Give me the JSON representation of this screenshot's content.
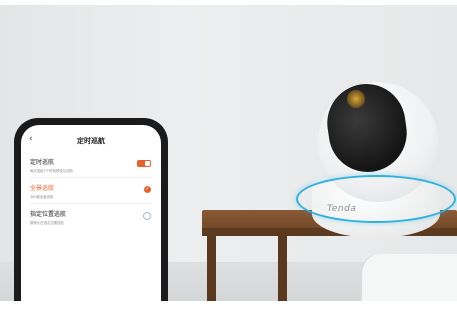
{
  "camera": {
    "brand": "Tenda"
  },
  "phone": {
    "screen_title": "定时巡航",
    "items": [
      {
        "title": "定时巡航",
        "subtitle": "每天巡航2个时段预设位巡航",
        "control": "toggle-on"
      },
      {
        "title": "全景巡航",
        "subtitle": "360度全景巡航",
        "control": "checked"
      },
      {
        "title": "指定位置巡航",
        "subtitle": "摄像头在指定位置巡航",
        "control": "unchecked"
      }
    ]
  },
  "colors": {
    "accent": "#e8612c",
    "ring": "#2fb1de"
  }
}
